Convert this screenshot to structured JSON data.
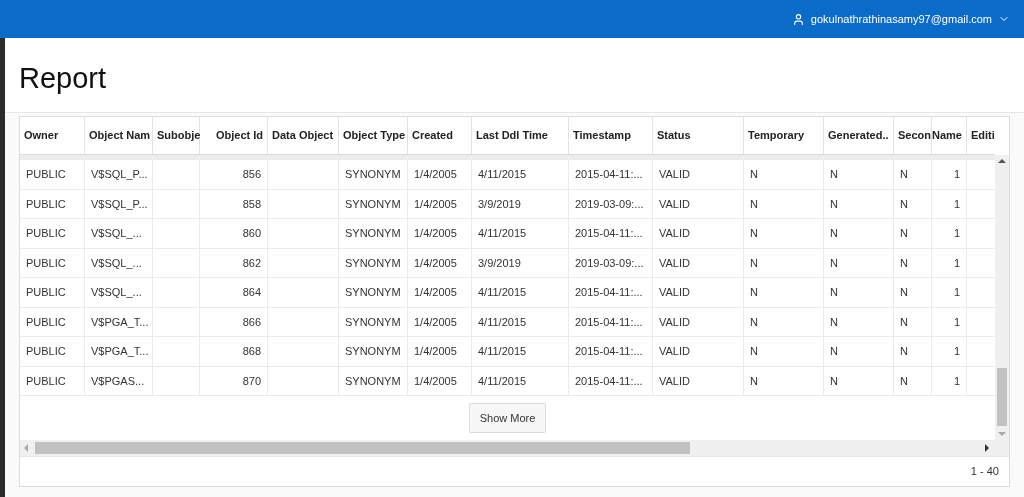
{
  "top_bar": {
    "user": "gokulnathrathinasamy97@gmail.com"
  },
  "title": "Report",
  "table": {
    "columns": [
      "Owner",
      "Object Nam",
      "Subobje",
      "Object Id",
      "Data Object",
      "Object Type",
      "Created",
      "Last Ddl Time",
      "Timestamp",
      "Status",
      "Temporary",
      "Generated..",
      "Secon",
      "Name",
      "Editi"
    ],
    "rows": [
      [
        "PUBLIC",
        "V$SQL_P...",
        null,
        "856",
        null,
        "SYNONYM",
        "1/4/2005",
        "4/11/2015",
        "2015-04-11:...",
        "VALID",
        "N",
        "N",
        "N",
        "1",
        null
      ],
      [
        "PUBLIC",
        "V$SQL_P...",
        null,
        "858",
        null,
        "SYNONYM",
        "1/4/2005",
        "3/9/2019",
        "2019-03-09:...",
        "VALID",
        "N",
        "N",
        "N",
        "1",
        null
      ],
      [
        "PUBLIC",
        "V$SQL_...",
        null,
        "860",
        null,
        "SYNONYM",
        "1/4/2005",
        "4/11/2015",
        "2015-04-11:...",
        "VALID",
        "N",
        "N",
        "N",
        "1",
        null
      ],
      [
        "PUBLIC",
        "V$SQL_...",
        null,
        "862",
        null,
        "SYNONYM",
        "1/4/2005",
        "3/9/2019",
        "2019-03-09:...",
        "VALID",
        "N",
        "N",
        "N",
        "1",
        null
      ],
      [
        "PUBLIC",
        "V$SQL_...",
        null,
        "864",
        null,
        "SYNONYM",
        "1/4/2005",
        "4/11/2015",
        "2015-04-11:...",
        "VALID",
        "N",
        "N",
        "N",
        "1",
        null
      ],
      [
        "PUBLIC",
        "V$PGA_T...",
        null,
        "866",
        null,
        "SYNONYM",
        "1/4/2005",
        "4/11/2015",
        "2015-04-11:...",
        "VALID",
        "N",
        "N",
        "N",
        "1",
        null
      ],
      [
        "PUBLIC",
        "V$PGA_T...",
        null,
        "868",
        null,
        "SYNONYM",
        "1/4/2005",
        "4/11/2015",
        "2015-04-11:...",
        "VALID",
        "N",
        "N",
        "N",
        "1",
        null
      ],
      [
        "PUBLIC",
        "V$PGAS...",
        null,
        "870",
        null,
        "SYNONYM",
        "1/4/2005",
        "4/11/2015",
        "2015-04-11:...",
        "VALID",
        "N",
        "N",
        "N",
        "1",
        null
      ]
    ],
    "show_more": "Show More",
    "range": "1 - 40"
  }
}
